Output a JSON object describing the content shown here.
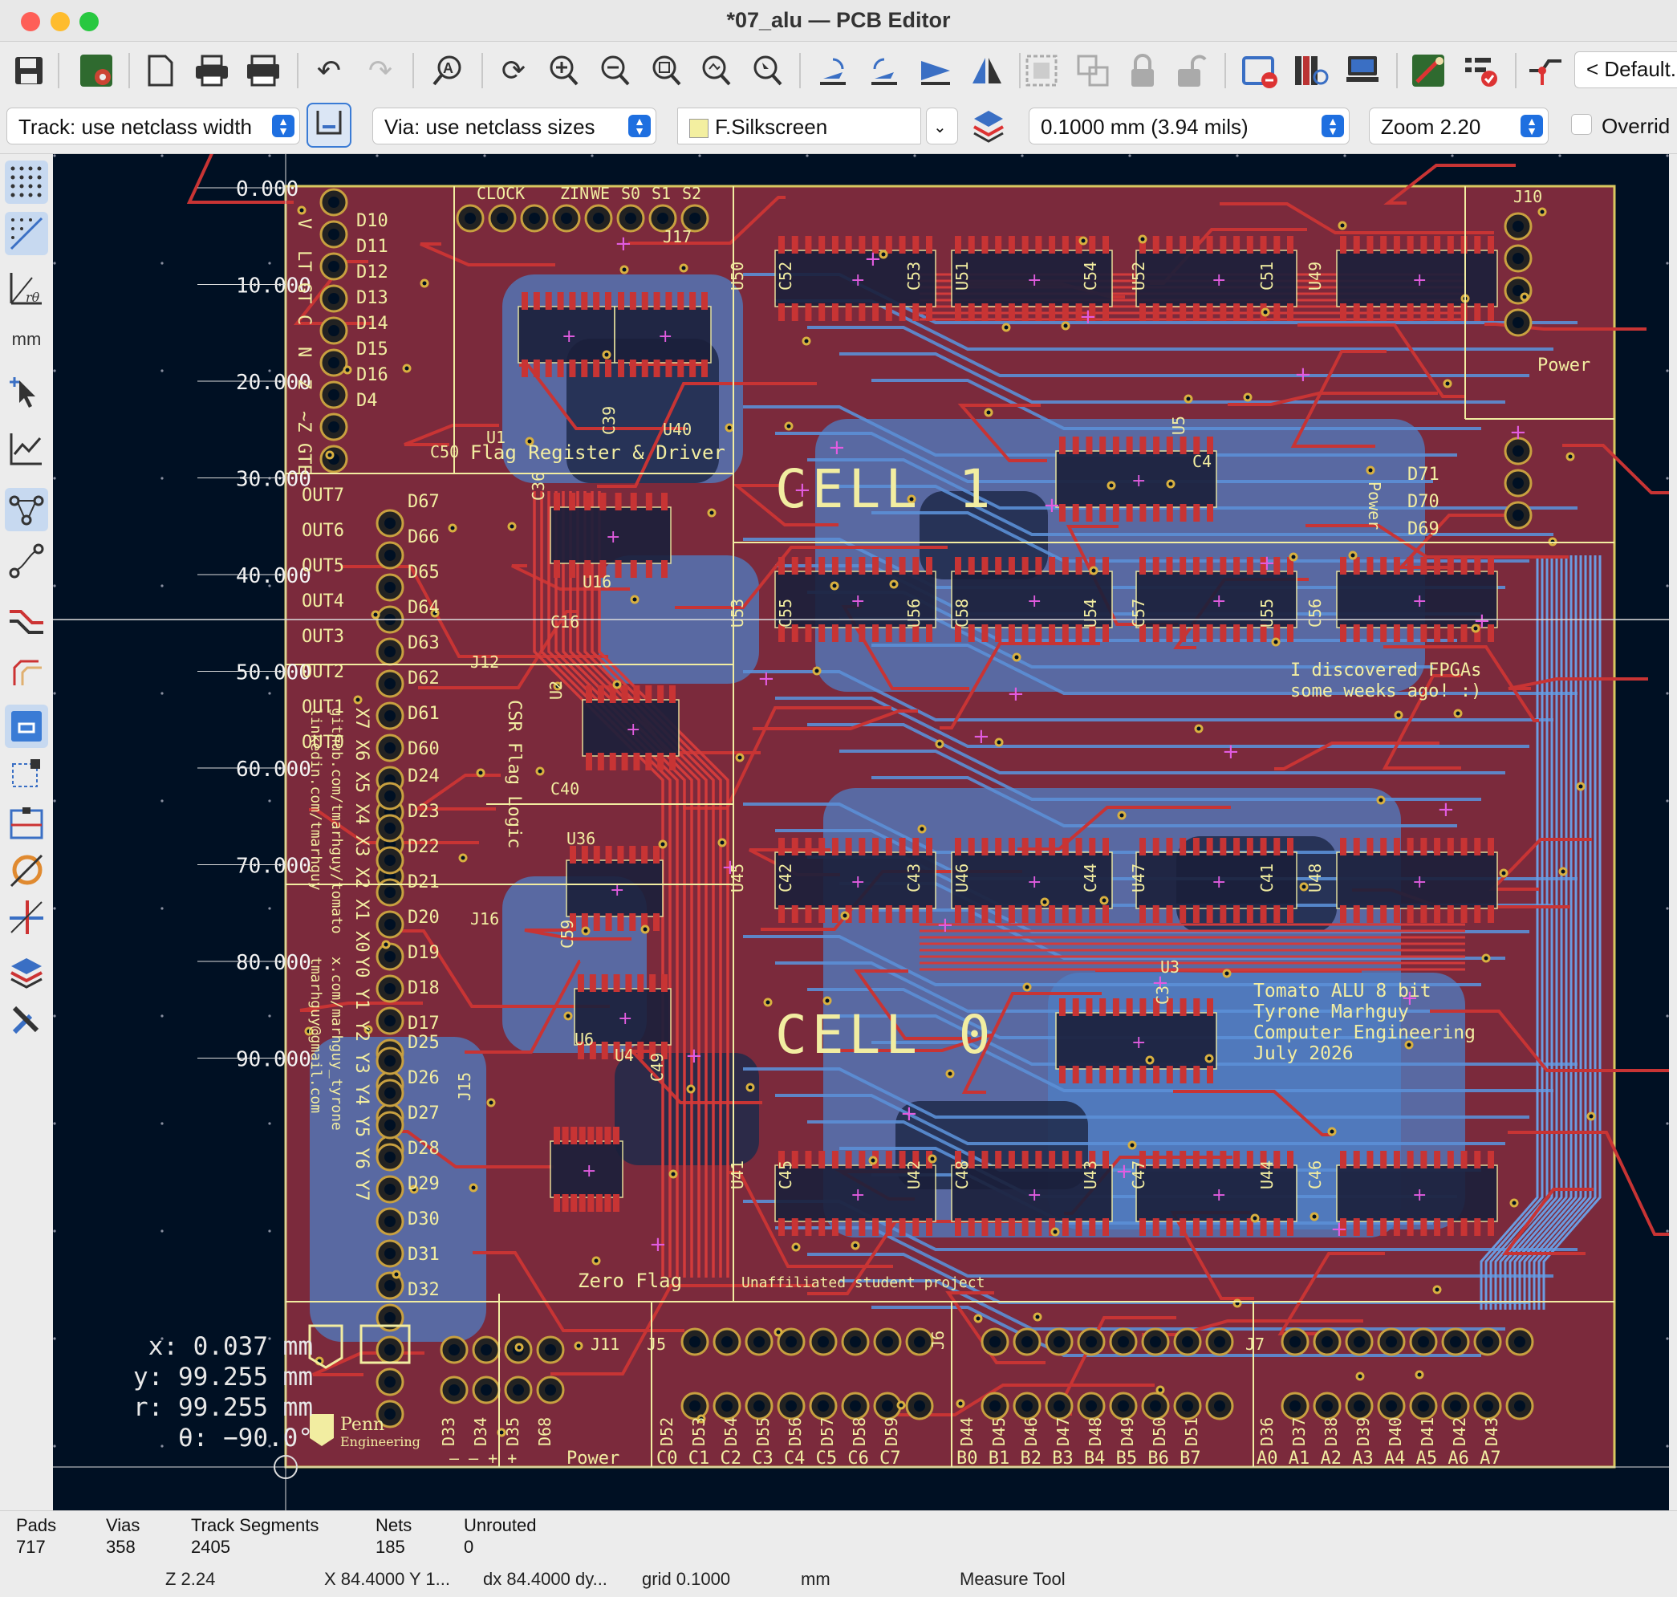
{
  "window": {
    "title": "*07_alu — PCB Editor"
  },
  "toolbar": {
    "preset_label": "< Default.",
    "icons": [
      "save-icon",
      "board-setup-icon",
      "page-icon",
      "print-icon",
      "plot-icon",
      "undo-icon",
      "redo-icon",
      "find-icon",
      "refresh-icon",
      "zoom-in-icon",
      "zoom-out-icon",
      "zoom-fit-icon",
      "zoom-objects-icon",
      "zoom-selection-icon",
      "rotate-ccw-icon",
      "rotate-cw-icon",
      "flip-icon",
      "mirror-icon",
      "group-icon",
      "ungroup-icon",
      "lock-icon",
      "unlock-icon",
      "netlist-icon",
      "footprint-library-icon",
      "footprint-editor-icon",
      "scripting-icon",
      "drc-icon",
      "route-icon"
    ]
  },
  "toolbar2": {
    "track_width": "Track: use netclass width",
    "via_size": "Via: use netclass sizes",
    "layer": "F.Silkscreen",
    "grid": "0.1000 mm (3.94 mils)",
    "zoom": "Zoom 2.20",
    "override_label": "Overrid"
  },
  "left_toolbar": {
    "icons": [
      "grid-icon",
      "polar-icon",
      "polar-coords-icon",
      "units-mm-icon",
      "cursor-icon",
      "graph-icon",
      "ratsnest-icon",
      "curved-ratsnest-icon",
      "highlight-tracks-icon",
      "zone-outline-icon",
      "track-outline-icon",
      "select-filter-icon",
      "dimension-icon",
      "net-inspector-icon",
      "measure-icon",
      "layers-icon",
      "properties-icon"
    ],
    "units_label": "mm"
  },
  "ruler": {
    "labels": [
      "0.000",
      "10.000",
      "20.000",
      "30.000",
      "40.000",
      "50.000",
      "60.000",
      "70.000",
      "80.000",
      "90.000"
    ]
  },
  "pcb": {
    "cell_labels": [
      "CELL 1",
      "CELL 0"
    ],
    "silkscreen": {
      "flag_register": "Flag Register & Driver",
      "csr_flag_logic": "CSR Flag Logic",
      "zero_flag": "Zero Flag",
      "fpga_note": [
        "I discovered FPGAs",
        "some weeks ago! :)"
      ],
      "credits": [
        "Tomato ALU 8 bit",
        "Tyrone Marhguy",
        "Computer Engineering",
        "July 2026"
      ],
      "unaffiliated": "Unaffiliated student project",
      "power": "Power",
      "power_side": "Power",
      "clock": "CLOCK",
      "control_pins": [
        "ZIN",
        "WE",
        "S0",
        "S1",
        "S2"
      ],
      "flags": [
        "V",
        "LT",
        "GT",
        "C",
        "N",
        "Z",
        "~Z",
        "GTE"
      ],
      "outs": [
        "OUT7",
        "OUT6",
        "OUT5",
        "OUT4",
        "OUT3",
        "OUT2",
        "OUT1",
        "OUT0"
      ],
      "x_inputs": "X7 X6 X5 X4 X3 X2 X1 X0",
      "y_inputs": "Y0 Y1 Y2 Y3 Y4 Y5 Y6 Y7",
      "github": "github.com/tmarhguy/tomato",
      "linkedin": "linkedin.com/tmarhguy",
      "x_com": "x.com/marhguy_tyrone",
      "email": "tmarhguy@gmail.com",
      "c_bus": "C0 C1 C2 C3 C4 C5 C6 C7",
      "b_bus": "B0 B1 B2 B3 B4 B5 B6 B7",
      "a_bus": "A0 A1 A2 A3 A4 A5 A6 A7",
      "power_pins": "– – + +",
      "penn": "Penn",
      "engineering": "Engineering"
    },
    "refs": {
      "d_top": [
        "D10",
        "D11",
        "D12",
        "D13",
        "D14",
        "D15",
        "D16",
        "D4"
      ],
      "d_out": [
        "D67",
        "D66",
        "D65",
        "D64",
        "D63",
        "D62",
        "D61",
        "D60"
      ],
      "d_x": [
        "D24",
        "D23",
        "D22",
        "D21",
        "D20",
        "D19",
        "D18",
        "D17"
      ],
      "d_y": [
        "D25",
        "D26",
        "D27",
        "D28",
        "D29",
        "D30",
        "D31",
        "D32"
      ],
      "d_c": [
        "D52",
        "D53",
        "D54",
        "D55",
        "D56",
        "D57",
        "D58",
        "D59"
      ],
      "d_b": [
        "D44",
        "D45",
        "D46",
        "D47",
        "D48",
        "D49",
        "D50",
        "D51"
      ],
      "d_a": [
        "D36",
        "D37",
        "D38",
        "D39",
        "D40",
        "D41",
        "D42",
        "D43"
      ],
      "d_pwr": [
        "D33",
        "D34",
        "D35",
        "D68"
      ],
      "d_right": [
        "D71",
        "D70",
        "D69"
      ],
      "upper_ics": [
        "U50",
        "C52",
        "C53",
        "U51",
        "C54",
        "U52",
        "C51",
        "U49"
      ],
      "mid_ics": [
        "U53",
        "C55",
        "U56",
        "C58",
        "U54",
        "C57",
        "U55",
        "C56"
      ],
      "lower_ics": [
        "U45",
        "C42",
        "C43",
        "U46",
        "C44",
        "U47",
        "C41",
        "U48"
      ],
      "bottom_ics": [
        "U41",
        "C45",
        "U42",
        "C48",
        "U43",
        "C47",
        "U44",
        "C46"
      ],
      "misc": [
        "U1",
        "C50",
        "C39",
        "U40",
        "J17",
        "C36",
        "U16",
        "C16",
        "U2",
        "C40",
        "U36",
        "C59",
        "U6",
        "U4",
        "C49",
        "J12",
        "J16",
        "J15",
        "J11",
        "J5",
        "J6",
        "J7",
        "J10",
        "U5",
        "C4",
        "U3",
        "C3"
      ]
    }
  },
  "cursor_readout": {
    "x": "x: 0.037  mm",
    "y": "y: 99.255  mm",
    "r": "r: 99.255  mm",
    "theta": "θ: −90.0°"
  },
  "status": {
    "stats": [
      {
        "label": "Pads",
        "value": "717"
      },
      {
        "label": "Vias",
        "value": "358"
      },
      {
        "label": "Track Segments",
        "value": "2405"
      },
      {
        "label": "Nets",
        "value": "185"
      },
      {
        "label": "Unrouted",
        "value": "0"
      }
    ],
    "zoom": "Z 2.24",
    "position": "X 84.4000  Y 1...",
    "delta": "dx 84.4000  dy...",
    "grid": "grid 0.1000",
    "units": "mm",
    "tool": "Measure Tool"
  },
  "colors": {
    "canvas_bg": "#001023",
    "front_copper": "#c83434",
    "back_copper": "#4d7fc4",
    "board_fill": "#7b2a3c",
    "silkscreen": "#f2eda1",
    "pad": "#c8a040",
    "via": "#e25ce0"
  }
}
